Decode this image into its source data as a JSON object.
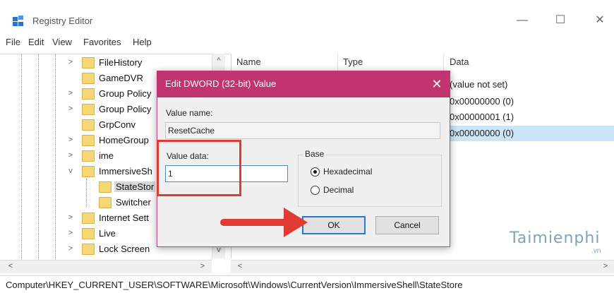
{
  "window": {
    "title": "Registry Editor",
    "minimize_glyph": "—",
    "maximize_glyph": "☐",
    "close_glyph": "✕"
  },
  "menu": [
    "File",
    "Edit",
    "View",
    "Favorites",
    "Help"
  ],
  "tree": {
    "items": [
      {
        "label": "FileHistory",
        "expander": ">"
      },
      {
        "label": "GameDVR",
        "expander": ""
      },
      {
        "label": "Group Policy",
        "expander": ">"
      },
      {
        "label": "Group Policy",
        "expander": ">"
      },
      {
        "label": "GrpConv",
        "expander": ""
      },
      {
        "label": "HomeGroup",
        "expander": ">"
      },
      {
        "label": "ime",
        "expander": ">"
      },
      {
        "label": "ImmersiveSh",
        "expander": "v"
      },
      {
        "label": "StateStor",
        "expander": "",
        "selected": true
      },
      {
        "label": "Switcher",
        "expander": ""
      },
      {
        "label": "Internet Sett",
        "expander": ">"
      },
      {
        "label": "Live",
        "expander": ">"
      },
      {
        "label": "Lock Screen",
        "expander": ">"
      }
    ],
    "scroll_up": "^",
    "scroll_down": "v",
    "scroll_left": "<",
    "scroll_right": ">"
  },
  "list": {
    "columns": {
      "name": "Name",
      "type": "Type",
      "data": "Data"
    },
    "data_values": [
      "(value not set)",
      "0x00000000 (0)",
      "0x00000001 (1)",
      "0x00000000 (0)"
    ],
    "scroll_left": "<",
    "scroll_right": ">"
  },
  "dialog": {
    "title": "Edit DWORD (32-bit) Value",
    "close_glyph": "✕",
    "value_name_label": "Value name:",
    "value_name": "ResetCache",
    "value_data_label": "Value data:",
    "value_data": "1",
    "base_label": "Base",
    "radio_hex": "Hexadecimal",
    "radio_dec": "Decimal",
    "selected_base": "Hexadecimal",
    "ok_label": "OK",
    "cancel_label": "Cancel",
    "accent_color": "#c1346f"
  },
  "status_bar": {
    "path": "Computer\\HKEY_CURRENT_USER\\SOFTWARE\\Microsoft\\Windows\\CurrentVersion\\ImmersiveShell\\StateStore"
  },
  "watermark": {
    "text": "Taimienphi",
    "sub": ".vn"
  },
  "annotation": {
    "highlight_color": "#e23b34"
  }
}
